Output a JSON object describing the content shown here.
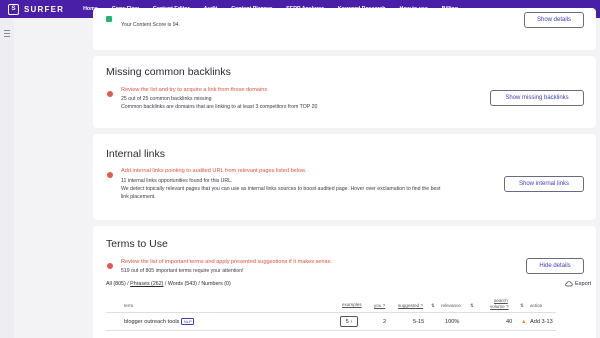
{
  "nav": {
    "brand": "SURFER",
    "brand_logo": "S",
    "items": [
      "Home",
      "Grow Flow",
      "Content Editor",
      "Audit",
      "Content Planner",
      "SERP Analyzer",
      "Keyword Research",
      "How to use",
      "Billing"
    ]
  },
  "top_card": {
    "score_text": "Your Content Score is 94.",
    "button": "Show details"
  },
  "backlinks": {
    "title": "Missing common backlinks",
    "alert": "Review the list and try to acquire a link from those domains",
    "line1": "25 out of 25 common backlinks missing",
    "line2": "Common backlinks are domains that are linking to at least 3 competitors from TOP 20",
    "button": "Show missing backlinks"
  },
  "internal": {
    "title": "Internal links",
    "alert": "Add internal links pointing to audited URL from relevant pages listed below.",
    "line1": "11 internal links opportunities found for this URL.",
    "line2": "We detect topically relevant pages that you can use as internal links sources to boost audited page. Hover over exclamation to find the best",
    "line3": "link placement.",
    "button": "Show internal links"
  },
  "terms": {
    "title": "Terms to Use",
    "alert": "Review the list of important terms and apply presented suggestions if it makes sense.",
    "line1": "519 out of 805 important terms require your attention!",
    "button": "Hide details",
    "filter_all": "All (805) /",
    "filter_phrases": "Phrases (262)",
    "filter_rest": "/ Words (543) / Numbers (0)",
    "export": "Export",
    "headers": {
      "term": "term",
      "examples": "examples",
      "you": "you ?",
      "suggested": "suggested ?",
      "relevance": "relevance",
      "search_volume_1": "search",
      "search_volume_2": "volume ?",
      "action": "action"
    },
    "rows": [
      {
        "term": "blogger outreach tools",
        "badge": "NLP",
        "examples": "5",
        "you": "2",
        "suggested": "5-15",
        "relevance": "100%",
        "volume": "40",
        "action": "Add 3-13",
        "action_color": "#f08a1c"
      }
    ]
  },
  "colors": {
    "nav_bg": "#4a1fa8",
    "alert_red": "#e0513f",
    "link_blue": "#3c3cc0",
    "ok_green": "#22b573",
    "warn_orange": "#f08a1c"
  }
}
